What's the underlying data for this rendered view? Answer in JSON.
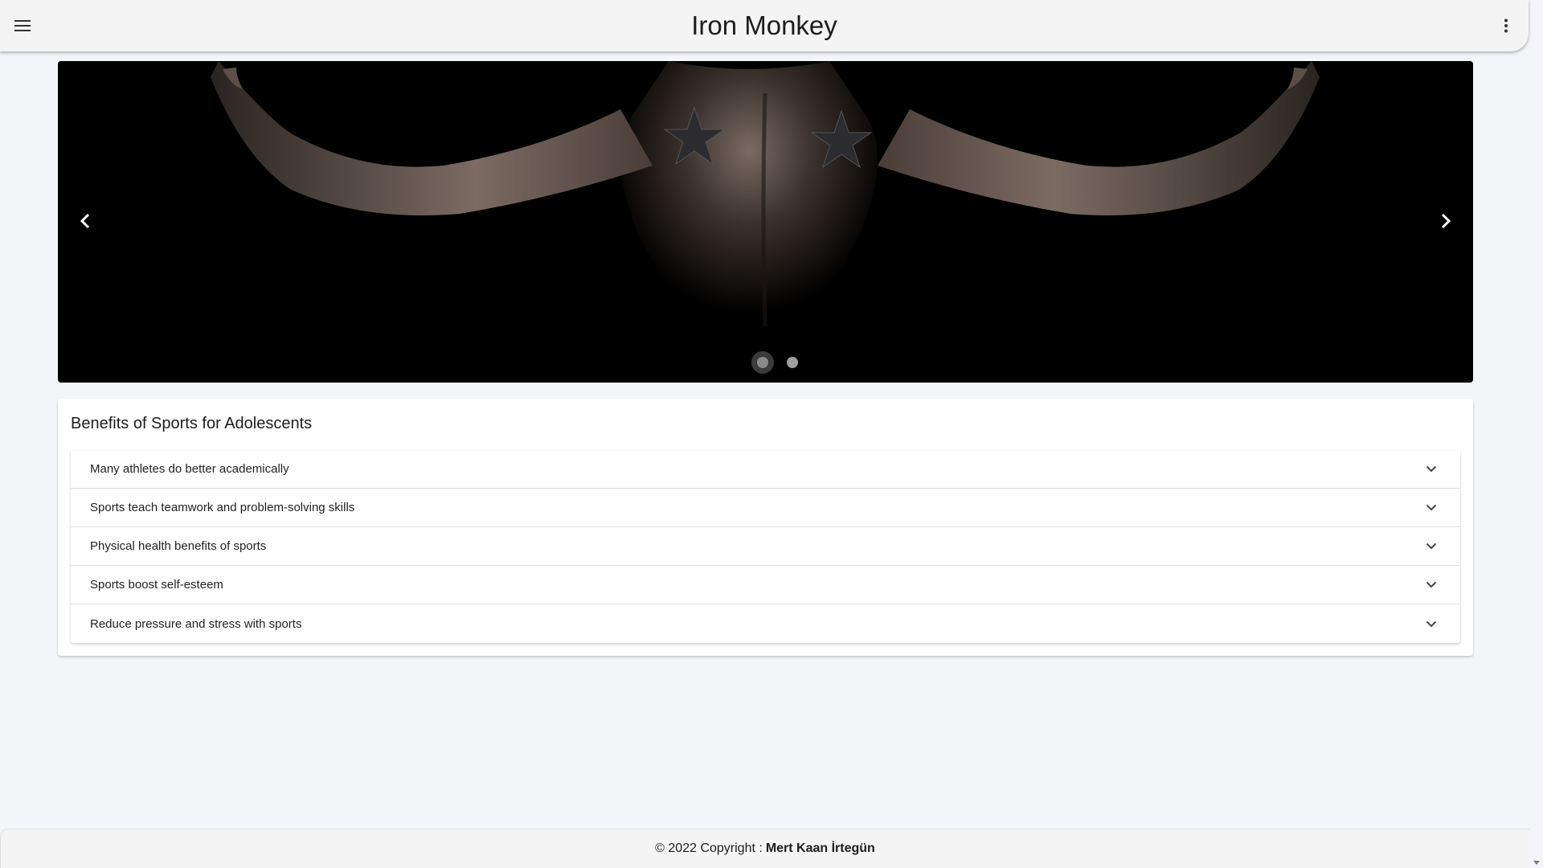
{
  "app_bar": {
    "title": "Iron Monkey",
    "menu_icon": "menu-icon",
    "more_icon": "more-vert-icon"
  },
  "carousel": {
    "image_description_icon": "hero-image",
    "prev_icon": "chevron-left-icon",
    "next_icon": "chevron-right-icon",
    "slide_count": 2,
    "active_slide": 1
  },
  "benefits": {
    "title": "Benefits of Sports for Adolescents",
    "items": [
      {
        "label": "Many athletes do better academically"
      },
      {
        "label": "Sports teach teamwork and problem-solving skills"
      },
      {
        "label": "Physical health benefits of sports"
      },
      {
        "label": "Sports boost self-esteem"
      },
      {
        "label": "Reduce pressure and stress with sports"
      }
    ]
  },
  "footer": {
    "copyright": "© 2022 Copyright :",
    "author": "Mert Kaan İrtegün"
  },
  "colors": {
    "page_bg": "#f4f5f8",
    "bar_bg": "#f4f4f4",
    "card_bg": "#ffffff",
    "hero_bg": "#000000"
  }
}
